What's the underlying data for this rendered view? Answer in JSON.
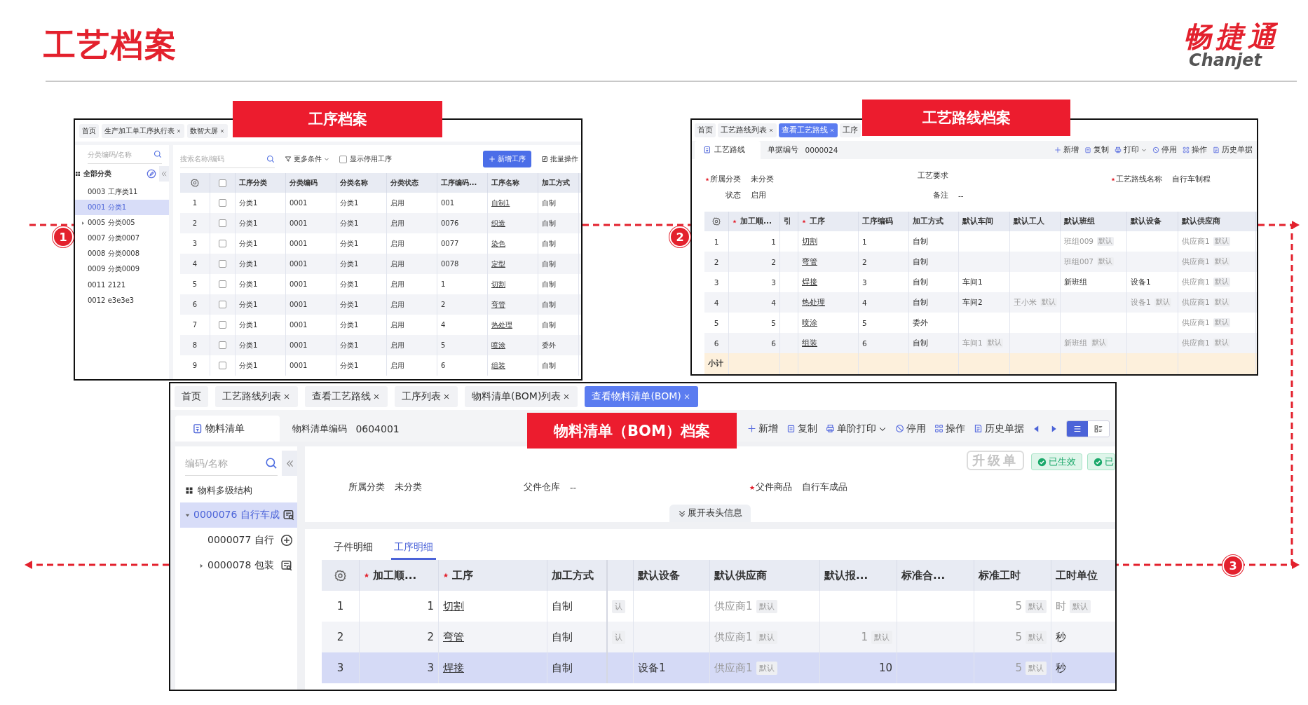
{
  "header": {
    "title": "工艺档案",
    "logo": {
      "mark": "畅捷通",
      "wordmark": "Chanjet"
    }
  },
  "steps": [
    {
      "number": "1"
    },
    {
      "number": "2"
    },
    {
      "number": "3"
    }
  ],
  "panels": [
    {
      "kind": "process_archive",
      "callout": "工序档案",
      "tabs": [
        {
          "label": "首页",
          "closable": false,
          "selected": false
        },
        {
          "label": "生产加工单工序执行表",
          "closable": true,
          "selected": false
        },
        {
          "label": "数智大屏",
          "closable": true,
          "selected": false
        }
      ],
      "sidebar": {
        "search": {
          "placeholder": "分类编码/名称"
        },
        "root": "全部分类",
        "items": [
          {
            "label": "0003 工序类11",
            "kind": "leaf",
            "selected": false
          },
          {
            "label": "0001 分类1",
            "kind": "leaf",
            "selected": true
          },
          {
            "label": "0005 分类005",
            "kind": "collapsed",
            "selected": false
          },
          {
            "label": "0007 分类0007",
            "kind": "leaf",
            "selected": false
          },
          {
            "label": "0008 分类0008",
            "kind": "leaf",
            "selected": false
          },
          {
            "label": "0009 分类0009",
            "kind": "leaf",
            "selected": false
          },
          {
            "label": "0011 2121",
            "kind": "leaf",
            "selected": false
          },
          {
            "label": "0012 e3e3e3",
            "kind": "leaf",
            "selected": false
          }
        ]
      },
      "toolbar": {
        "search": {
          "placeholder": "搜索名称/编码"
        },
        "filter": "更多条件",
        "show_disabled": {
          "label": "显示停用工序",
          "checked": false
        },
        "add_button": "新增工序",
        "batch_button": "批量操作"
      },
      "table": {
        "header_checked": false,
        "columns": [
          {
            "kind": "index"
          },
          {
            "kind": "check"
          },
          {
            "label": "工序分类",
            "kind": "text"
          },
          {
            "label": "分类编码",
            "kind": "text"
          },
          {
            "label": "分类名称",
            "kind": "text"
          },
          {
            "label": "分类状态",
            "kind": "text"
          },
          {
            "label": "工序编码...",
            "kind": "text"
          },
          {
            "label": "工序名称",
            "kind": "link"
          },
          {
            "label": "加工方式",
            "kind": "text"
          }
        ],
        "rows": [
          {
            "checked": false,
            "cells": [
              "1",
              "",
              "分类1",
              "0001",
              "分类1",
              "启用",
              "001",
              "自制1",
              "自制"
            ]
          },
          {
            "checked": false,
            "cells": [
              "2",
              "",
              "分类1",
              "0001",
              "分类1",
              "启用",
              "0076",
              "织造",
              "自制"
            ]
          },
          {
            "checked": false,
            "cells": [
              "3",
              "",
              "分类1",
              "0001",
              "分类1",
              "启用",
              "0077",
              "染色",
              "自制"
            ]
          },
          {
            "checked": false,
            "cells": [
              "4",
              "",
              "分类1",
              "0001",
              "分类1",
              "启用",
              "0078",
              "定型",
              "自制"
            ]
          },
          {
            "checked": false,
            "cells": [
              "5",
              "",
              "分类1",
              "0001",
              "分类1",
              "启用",
              "1",
              "切割",
              "自制"
            ]
          },
          {
            "checked": false,
            "cells": [
              "6",
              "",
              "分类1",
              "0001",
              "分类1",
              "启用",
              "2",
              "弯管",
              "自制"
            ]
          },
          {
            "checked": false,
            "cells": [
              "7",
              "",
              "分类1",
              "0001",
              "分类1",
              "启用",
              "4",
              "热处理",
              "自制"
            ]
          },
          {
            "checked": false,
            "cells": [
              "8",
              "",
              "分类1",
              "0001",
              "分类1",
              "启用",
              "5",
              "喷涂",
              "委外"
            ]
          },
          {
            "checked": false,
            "cells": [
              "9",
              "",
              "分类1",
              "0001",
              "分类1",
              "启用",
              "6",
              "组装",
              "自制"
            ]
          }
        ]
      }
    },
    {
      "kind": "routing_archive",
      "callout": "工艺路线档案",
      "tabs": [
        {
          "label": "首页",
          "closable": false,
          "selected": false
        },
        {
          "label": "工艺路线列表",
          "closable": true,
          "selected": false
        },
        {
          "label": "查看工艺路线",
          "closable": true,
          "selected": true
        },
        {
          "label": "工序",
          "closable": false,
          "selected": false
        }
      ],
      "document": {
        "tab": "工艺路线",
        "number_label": "单据编号",
        "number": "0000024"
      },
      "actions": [
        {
          "kind": "add",
          "label": "新增",
          "dropdown": false
        },
        {
          "kind": "copy",
          "label": "复制",
          "dropdown": false
        },
        {
          "kind": "print",
          "label": "打印",
          "dropdown": true
        },
        {
          "kind": "disable",
          "label": "停用",
          "dropdown": false
        },
        {
          "kind": "operate",
          "label": "操作",
          "dropdown": false
        },
        {
          "kind": "history",
          "label": "历史单据",
          "dropdown": false
        }
      ],
      "form": [
        {
          "label": "所属分类",
          "value": "未分类",
          "required": true
        },
        {
          "label": "状态",
          "value": "启用",
          "required": false
        },
        {
          "label": "工艺要求",
          "required": false
        },
        {
          "label": "备注",
          "value": "--",
          "required": false
        },
        {
          "label": "工艺路线名称",
          "value": "自行车制程",
          "required": true
        }
      ],
      "table": {
        "columns": [
          {
            "kind": "index"
          },
          {
            "label": "加工顺...",
            "kind": "number",
            "required": true
          },
          {
            "label": "引",
            "kind": "text",
            "required": false
          },
          {
            "label": "工序",
            "kind": "link",
            "required": true
          },
          {
            "label": "工序编码",
            "kind": "text",
            "required": false
          },
          {
            "label": "加工方式",
            "kind": "text",
            "required": false
          },
          {
            "label": "默认车间",
            "kind": "text",
            "required": false
          },
          {
            "label": "默认工人",
            "kind": "text",
            "required": false
          },
          {
            "label": "默认班组",
            "kind": "text",
            "required": false
          },
          {
            "label": "默认设备",
            "kind": "text",
            "required": false
          },
          {
            "label": "默认供应商",
            "kind": "text",
            "required": false
          }
        ],
        "rows": [
          {
            "cells": [
              "1",
              "1",
              null,
              "切割",
              "1",
              "自制",
              null,
              null,
              {
                "text": "班组009",
                "tag": "默认"
              },
              null,
              {
                "text": "供应商1",
                "tag": "默认"
              }
            ]
          },
          {
            "cells": [
              "2",
              "2",
              null,
              "弯管",
              "2",
              "自制",
              null,
              null,
              {
                "text": "班组007",
                "tag": "默认"
              },
              null,
              {
                "text": "供应商1",
                "tag": "默认"
              }
            ]
          },
          {
            "cells": [
              "3",
              "3",
              null,
              "焊接",
              "3",
              "自制",
              "车间1",
              null,
              "新班组",
              "设备1",
              {
                "text": "供应商1",
                "tag": "默认"
              }
            ]
          },
          {
            "cells": [
              "4",
              "4",
              null,
              "热处理",
              "4",
              "自制",
              "车间2",
              {
                "text": "王小米",
                "tag": "默认"
              },
              null,
              {
                "text": "设备1",
                "tag": "默认"
              },
              {
                "text": "供应商1",
                "tag": "默认"
              }
            ]
          },
          {
            "cells": [
              "5",
              "5",
              null,
              "喷涂",
              "5",
              "委外",
              null,
              null,
              null,
              null,
              {
                "text": "供应商1",
                "tag": "默认"
              }
            ]
          },
          {
            "cells": [
              "6",
              "6",
              null,
              "组装",
              "6",
              "自制",
              {
                "text": "车间1",
                "tag": "默认"
              },
              null,
              {
                "text": "新班组",
                "tag": "默认"
              },
              null,
              {
                "text": "供应商1",
                "tag": "默认"
              }
            ]
          }
        ],
        "summary": "小计"
      }
    },
    {
      "kind": "bom_archive",
      "callout": "物料清单（BOM）档案",
      "tabs": [
        {
          "label": "首页",
          "closable": false,
          "selected": false
        },
        {
          "label": "工艺路线列表",
          "closable": true,
          "selected": false
        },
        {
          "label": "查看工艺路线",
          "closable": true,
          "selected": false
        },
        {
          "label": "工序列表",
          "closable": true,
          "selected": false
        },
        {
          "label": "物料清单(BOM)列表",
          "closable": true,
          "selected": false
        },
        {
          "label": "查看物料清单(BOM)",
          "closable": true,
          "selected": true
        }
      ],
      "document": {
        "tab": "物料清单",
        "number_label": "物料清单编码",
        "number": "0604001"
      },
      "actions": [
        {
          "kind": "add",
          "label": "新增",
          "dropdown": false
        },
        {
          "kind": "copy",
          "label": "复制",
          "dropdown": false
        },
        {
          "kind": "print",
          "label": "单阶打印",
          "dropdown": true
        },
        {
          "kind": "disable",
          "label": "停用",
          "dropdown": false
        },
        {
          "kind": "operate",
          "label": "操作",
          "dropdown": false
        },
        {
          "kind": "history",
          "label": "历史单据",
          "dropdown": false
        }
      ],
      "view_modes": [
        {
          "kind": "list",
          "selected": true
        },
        {
          "kind": "card",
          "selected": false
        }
      ],
      "stamp": "升级单",
      "badges": [
        "已生效",
        "已"
      ],
      "sidebar": {
        "search": {
          "placeholder": "编码/名称"
        },
        "root": "物料多级结构",
        "items": [
          {
            "label": "0000076 自行车成",
            "kind": "expanded",
            "selected": true,
            "addable": false,
            "children": [
              {
                "label": "0000077 自行",
                "kind": "leaf",
                "selected": false,
                "addable": true
              },
              {
                "label": "0000078 包装",
                "kind": "collapsed",
                "selected": false,
                "addable": false
              }
            ]
          }
        ]
      },
      "form": [
        {
          "label": "所属分类",
          "value": "未分类",
          "required": false
        },
        {
          "label": "父件仓库",
          "value": "--",
          "required": false
        },
        {
          "label": "父件商品",
          "value": "自行车成品",
          "required": true
        }
      ],
      "expand_button": "展开表头信息",
      "detail_tabs": [
        {
          "label": "子件明细",
          "selected": false
        },
        {
          "label": "工序明细",
          "selected": true
        }
      ],
      "table": {
        "columns": [
          {
            "kind": "index"
          },
          {
            "label": "加工顺...",
            "kind": "number",
            "required": true
          },
          {
            "label": "工序",
            "kind": "link",
            "required": true
          },
          {
            "label": "加工方式",
            "kind": "text",
            "required": false
          },
          {
            "kind": "text",
            "required": false
          },
          {
            "label": "默认设备",
            "kind": "text",
            "required": false
          },
          {
            "label": "默认供应商",
            "kind": "text",
            "required": false
          },
          {
            "label": "默认报...",
            "kind": "number",
            "required": false
          },
          {
            "label": "标准合...",
            "kind": "text",
            "required": false
          },
          {
            "label": "标准工时",
            "kind": "number",
            "required": false
          },
          {
            "label": "工时单位",
            "kind": "text",
            "required": false
          }
        ],
        "rows": [
          {
            "selected": false,
            "cells": [
              "1",
              "1",
              "切割",
              "自制",
              {
                "tag": "认"
              },
              null,
              {
                "text": "供应商1",
                "tag": "默认"
              },
              null,
              null,
              {
                "text": "5",
                "tag": "默认"
              },
              {
                "text": "时",
                "tag": "默认"
              }
            ]
          },
          {
            "selected": false,
            "cells": [
              "2",
              "2",
              "弯管",
              "自制",
              {
                "tag": "认"
              },
              null,
              {
                "text": "供应商1",
                "tag": "默认"
              },
              {
                "text": "1",
                "tag": "默认"
              },
              null,
              {
                "text": "5",
                "tag": "默认"
              },
              "秒"
            ]
          },
          {
            "selected": true,
            "cells": [
              "3",
              "3",
              "焊接",
              "自制",
              null,
              "设备1",
              {
                "text": "供应商1",
                "tag": "默认"
              },
              "10",
              null,
              {
                "text": "5",
                "tag": "默认"
              },
              "秒"
            ]
          }
        ]
      }
    }
  ]
}
